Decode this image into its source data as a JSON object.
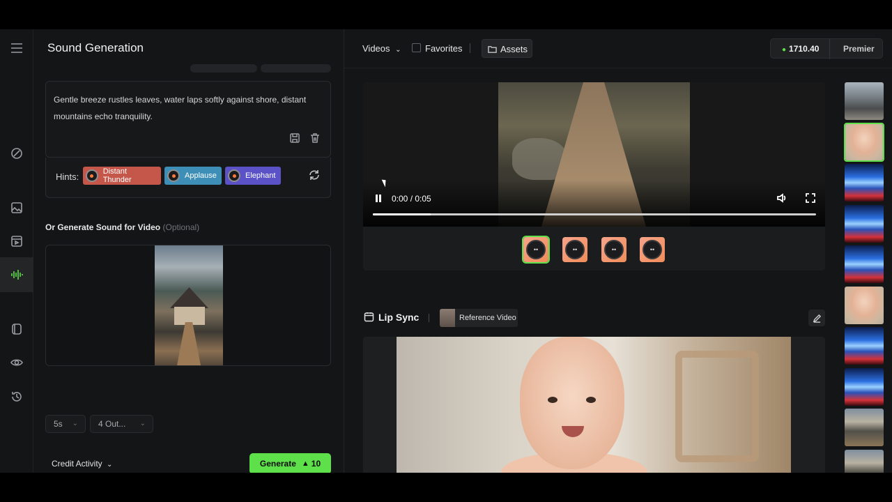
{
  "panel": {
    "title": "Sound Generation",
    "prompt": "Gentle breeze rustles leaves, water laps softly against shore, distant mountains echo tranquility.",
    "hints_label": "Hints:",
    "hints": [
      "Distant Thunder",
      "Applause",
      "Elephant"
    ],
    "hint_colors": [
      "#c4574a",
      "#3d8fb8",
      "#5b52c8"
    ],
    "video_section_title": "Or Generate Sound for Video",
    "video_section_optional": "(Optional)",
    "duration": "5s",
    "outputs": "4 Out...",
    "credit_activity": "Credit Activity",
    "generate_label": "Generate",
    "generate_cost": "10"
  },
  "topbar": {
    "videos": "Videos",
    "favorites": "Favorites",
    "assets": "Assets",
    "credits": "1710.40",
    "tier": "Premier"
  },
  "player": {
    "time": "0:00 / 0:05",
    "progress": 0.13,
    "tracks": 4,
    "selected_track": 0
  },
  "lip_sync": {
    "title": "Lip Sync",
    "reference_label": "Reference Video"
  },
  "thumbnails": [
    "street",
    "baby",
    "tunnel",
    "tunnel",
    "tunnel",
    "baby",
    "tunnel",
    "tunnel",
    "house",
    "house"
  ],
  "selected_thumbnail": 1,
  "colors": {
    "accent": "#5ee04a",
    "bg": "#141516"
  }
}
